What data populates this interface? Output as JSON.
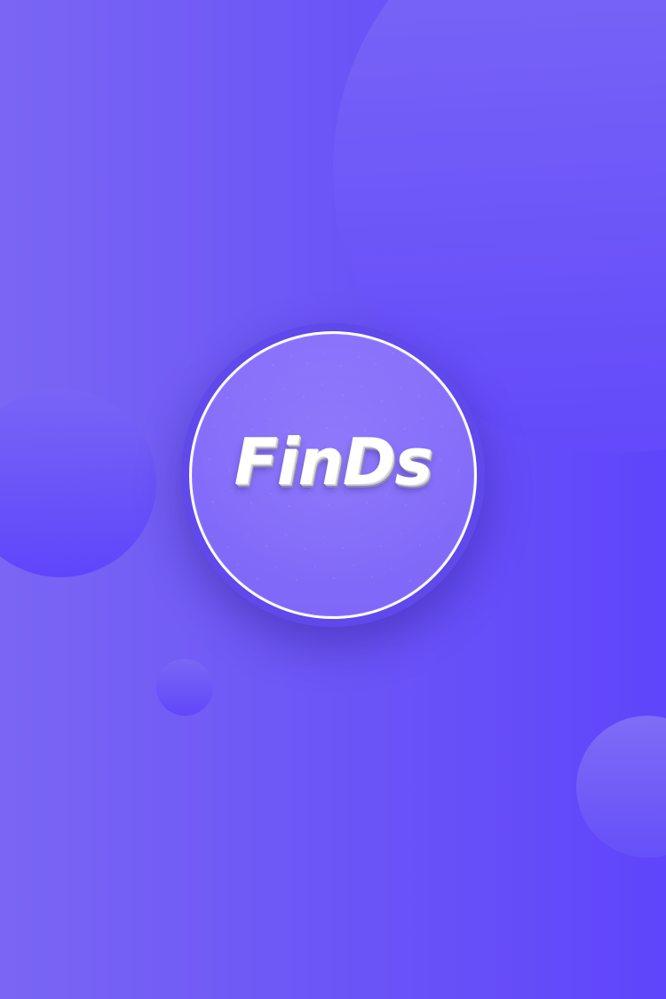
{
  "app": {
    "brand_name": "FinDs"
  },
  "theme": {
    "background_start": "#7a66f4",
    "background_end": "#5f45fb",
    "logo_ring": "#5f49eb",
    "logo_disc": "#8a72fb",
    "logo_outline": "#ffffff",
    "text": "#ffffff"
  }
}
